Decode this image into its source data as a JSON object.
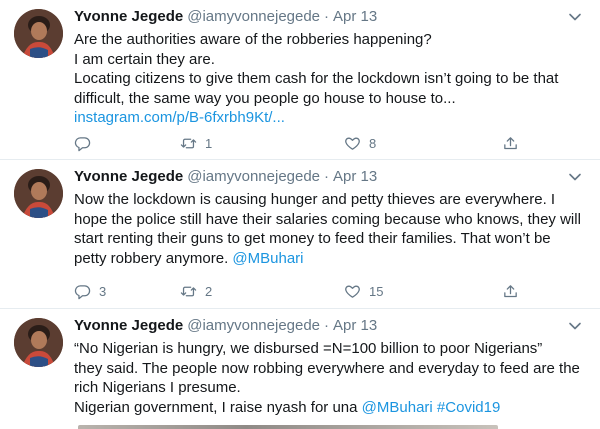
{
  "tweets": [
    {
      "author": {
        "name": "Yvonne Jegede",
        "handle": "@iamyvonnejegede"
      },
      "separator": "·",
      "date": "Apr 13",
      "lines": [
        "Are the authorities aware of the robberies happening?",
        "I am certain they are.",
        "Locating citizens to give them cash for the lockdown isn’t going to be that",
        "difficult, the same way you people go house to house to...",
        "instagram.com/p/B-6fxrbh9Kt/..."
      ],
      "stats": {
        "replies": "",
        "retweets": "1",
        "likes": "8"
      }
    },
    {
      "author": {
        "name": "Yvonne Jegede",
        "handle": "@iamyvonnejegede"
      },
      "separator": "·",
      "date": "Apr 13",
      "lines": [
        "Now the lockdown is causing hunger and petty thieves are everywhere. I",
        "hope the police still have their salaries coming because who knows, they will",
        "start renting their guns to get money to feed their families. That won’t be",
        "petty robbery anymore.",
        "@MBuhari"
      ],
      "stats": {
        "replies": "3",
        "retweets": "2",
        "likes": "15"
      }
    },
    {
      "author": {
        "name": "Yvonne Jegede",
        "handle": "@iamyvonnejegede"
      },
      "separator": "·",
      "date": "Apr 13",
      "lines": [
        "“No Nigerian is hungry, we disbursed =N=100 billion to poor Nigerians”",
        "they said. The people now robbing everywhere and everyday to feed are the",
        "rich Nigerians I presume.",
        "Nigerian government, I raise nyash for una",
        "@MBuhari",
        "#Covid19"
      ],
      "stats": {}
    }
  ],
  "icons": {
    "reply": "reply-icon",
    "retweet": "retweet-icon",
    "like": "heart-icon",
    "share": "share-icon",
    "more": "chevron-down-icon"
  },
  "colors": {
    "link": "#1b95e0",
    "text": "#14171a",
    "secondary": "#657786",
    "divider": "#e6ecf0"
  }
}
